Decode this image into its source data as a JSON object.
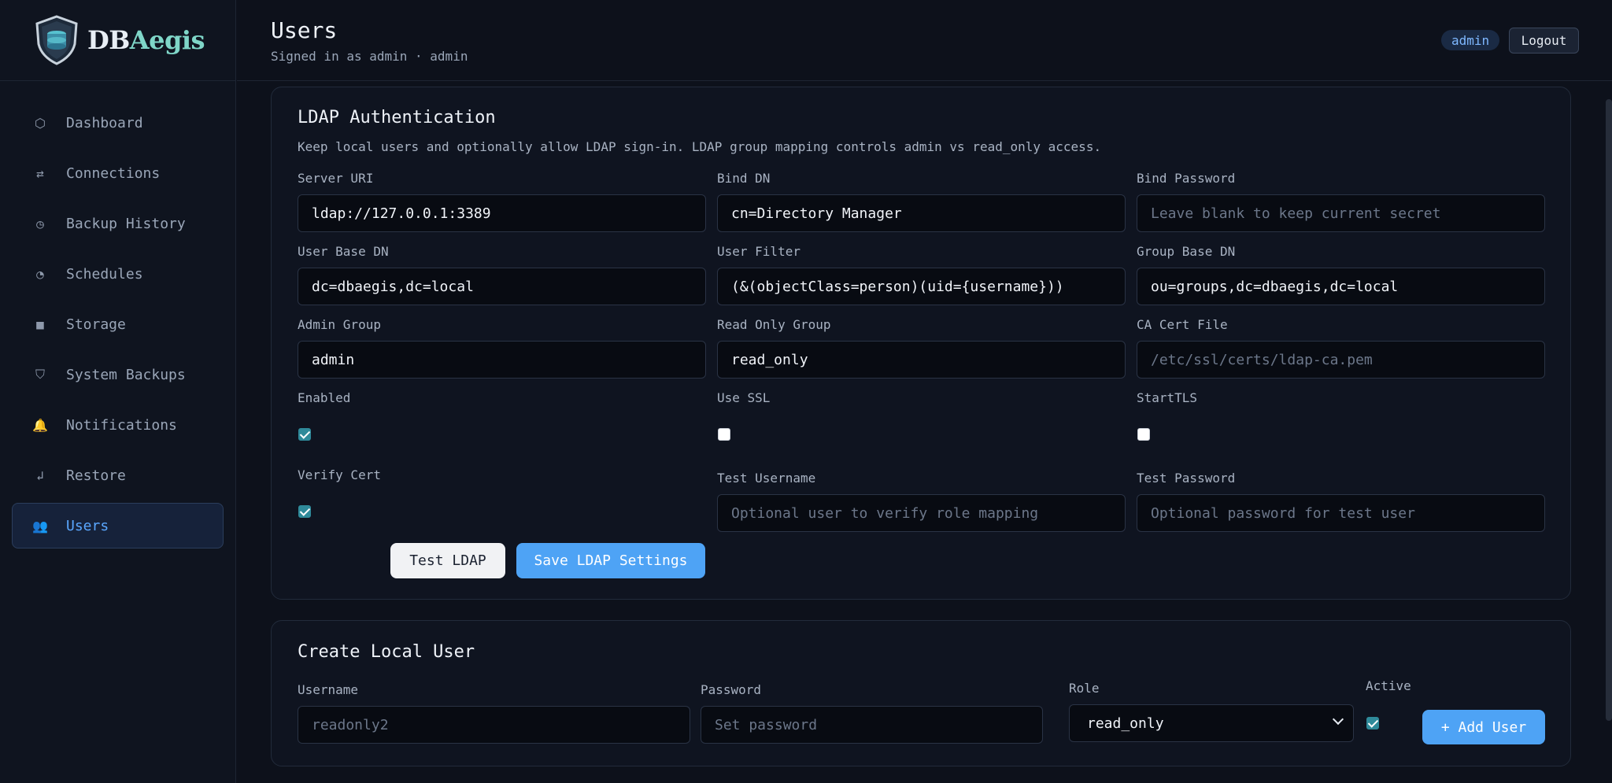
{
  "brand": {
    "name_main": "DB",
    "name_accent": "Aegis"
  },
  "sidebar": {
    "items": [
      {
        "label": "Dashboard",
        "icon": "hexagon-icon",
        "glyph": "⬡"
      },
      {
        "label": "Connections",
        "icon": "arrows-exchange-icon",
        "glyph": "⇄"
      },
      {
        "label": "Backup History",
        "icon": "clock-icon",
        "glyph": "◷"
      },
      {
        "label": "Schedules",
        "icon": "pie-chart-icon",
        "glyph": "◔"
      },
      {
        "label": "Storage",
        "icon": "storage-block-icon",
        "glyph": "■"
      },
      {
        "label": "System Backups",
        "icon": "shield-icon",
        "glyph": "⛉"
      },
      {
        "label": "Notifications",
        "icon": "bell-icon",
        "glyph": "🔔"
      },
      {
        "label": "Restore",
        "icon": "restore-arrow-icon",
        "glyph": "↲"
      },
      {
        "label": "Users",
        "icon": "users-icon",
        "glyph": "👥",
        "active": true
      }
    ]
  },
  "header": {
    "title": "Users",
    "subtitle": "Signed in as admin · admin",
    "role_badge": "admin",
    "logout_label": "Logout"
  },
  "ldap": {
    "title": "LDAP Authentication",
    "description": "Keep local users and optionally allow LDAP sign-in. LDAP group mapping controls admin vs read_only access.",
    "server_uri": {
      "label": "Server URI",
      "value": "ldap://127.0.0.1:3389"
    },
    "bind_dn": {
      "label": "Bind DN",
      "value": "cn=Directory Manager"
    },
    "bind_password": {
      "label": "Bind Password",
      "placeholder": "Leave blank to keep current secret"
    },
    "user_base_dn": {
      "label": "User Base DN",
      "value": "dc=dbaegis,dc=local"
    },
    "user_filter": {
      "label": "User Filter",
      "value": "(&(objectClass=person)(uid={username}))"
    },
    "group_base_dn": {
      "label": "Group Base DN",
      "value": "ou=groups,dc=dbaegis,dc=local"
    },
    "admin_group": {
      "label": "Admin Group",
      "value": "admin"
    },
    "read_only_group": {
      "label": "Read Only Group",
      "value": "read_only"
    },
    "ca_cert_file": {
      "label": "CA Cert File",
      "placeholder": "/etc/ssl/certs/ldap-ca.pem"
    },
    "enabled": {
      "label": "Enabled",
      "checked": true
    },
    "use_ssl": {
      "label": "Use SSL",
      "checked": false
    },
    "starttls": {
      "label": "StartTLS",
      "checked": false
    },
    "verify_cert": {
      "label": "Verify Cert",
      "checked": true
    },
    "test_username": {
      "label": "Test Username",
      "placeholder": "Optional user to verify role mapping"
    },
    "test_password": {
      "label": "Test Password",
      "placeholder": "Optional password for test user"
    },
    "test_button": "Test LDAP",
    "save_button": "Save LDAP Settings"
  },
  "create_user": {
    "title": "Create Local User",
    "username": {
      "label": "Username",
      "placeholder": "readonly2"
    },
    "password": {
      "label": "Password",
      "placeholder": "Set password"
    },
    "role": {
      "label": "Role",
      "value": "read_only"
    },
    "active": {
      "label": "Active",
      "checked": true
    },
    "add_button": "+ Add User"
  },
  "colors": {
    "accent": "#4ea3f5",
    "active_nav": "#5aa7ff",
    "checkbox": "#2f8a9a"
  }
}
